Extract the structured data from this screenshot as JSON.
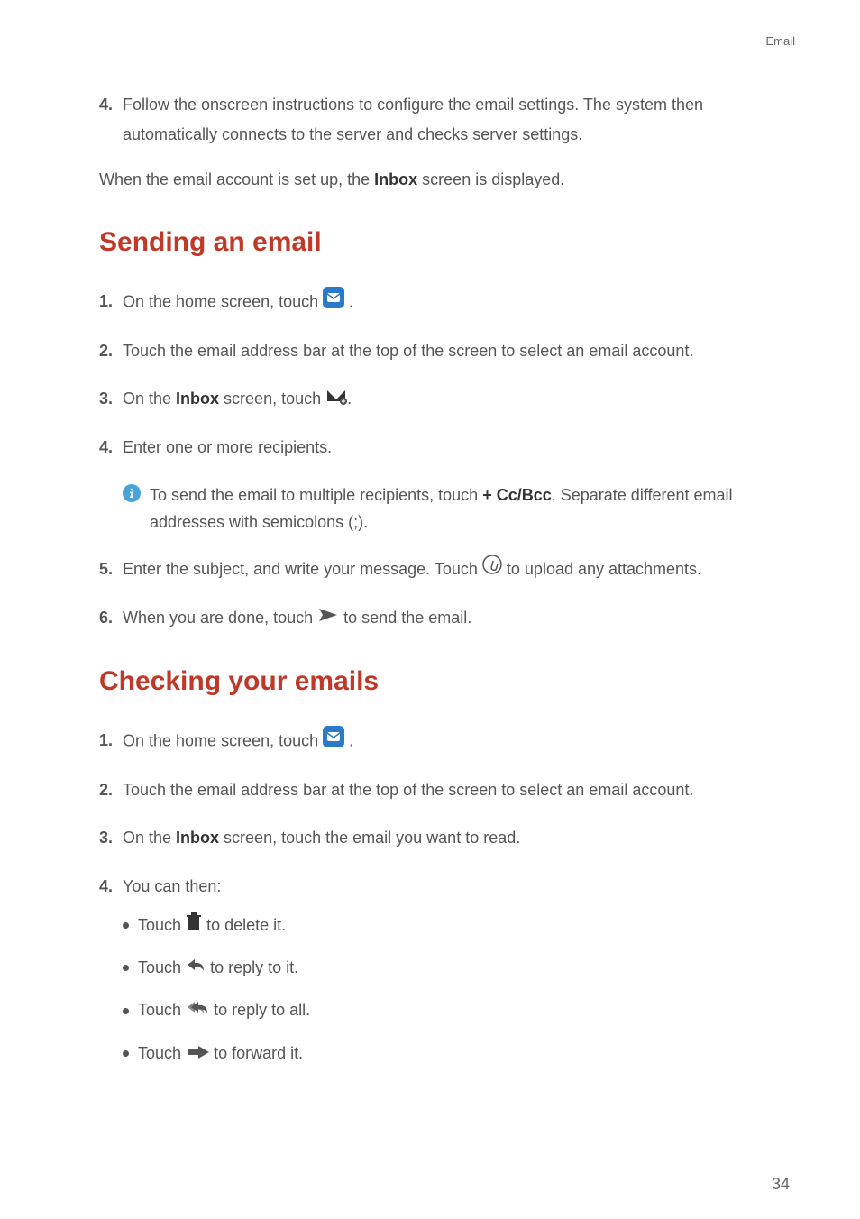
{
  "header": {
    "category": "Email"
  },
  "intro": {
    "step4_num": "4.",
    "step4_text": "Follow the onscreen instructions to configure the email settings. The system then automatically connects to the server and checks server settings.",
    "closing_pre": "When the email account is set up, the ",
    "closing_bold": "Inbox",
    "closing_post": " screen is displayed."
  },
  "sending": {
    "heading": "Sending an email",
    "s1_num": "1.",
    "s1_pre": "On the home screen, touch ",
    "s1_post": " .",
    "s2_num": "2.",
    "s2_text": "Touch the email address bar at the top of the screen to select an email account.",
    "s3_num": "3.",
    "s3_pre": "On the ",
    "s3_bold": "Inbox",
    "s3_mid": " screen, touch ",
    "s3_post": ".",
    "s4_num": "4.",
    "s4_text": "Enter one or more recipients.",
    "info_pre": "To send the email to multiple recipients, touch ",
    "info_bold": "+ Cc/Bcc",
    "info_post": ". Separate different email addresses with semicolons (;).",
    "s5_num": "5.",
    "s5_pre": "Enter the subject, and write your message. Touch ",
    "s5_post": " to upload any attachments.",
    "s6_num": "6.",
    "s6_pre": "When you are done, touch ",
    "s6_post": " to send the email."
  },
  "checking": {
    "heading": "Checking your emails",
    "s1_num": "1.",
    "s1_pre": "On the home screen, touch ",
    "s1_post": " .",
    "s2_num": "2.",
    "s2_text": "Touch the email address bar at the top of the screen to select an email account.",
    "s3_num": "3.",
    "s3_pre": "On the ",
    "s3_bold": "Inbox",
    "s3_post": " screen, touch the email you want to read.",
    "s4_num": "4.",
    "s4_text": "You can then:",
    "b1_pre": "Touch ",
    "b1_post": " to delete it.",
    "b2_pre": "Touch ",
    "b2_post": " to reply to it.",
    "b3_pre": "Touch ",
    "b3_post": " to reply to all.",
    "b4_pre": "Touch ",
    "b4_post": " to forward it."
  },
  "footer": {
    "page_number": "34"
  }
}
